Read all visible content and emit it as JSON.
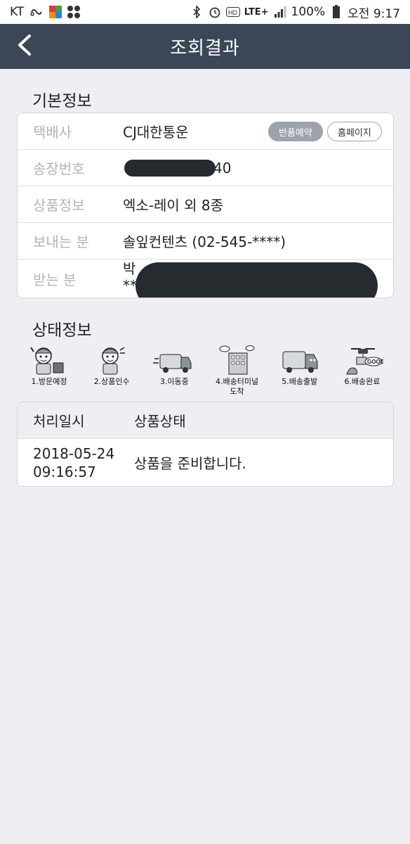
{
  "status_bar": {
    "carrier": "KT",
    "battery": "100%",
    "time": "오전 9:17",
    "network": "LTE+"
  },
  "header": {
    "title": "조회결과"
  },
  "basic_info": {
    "title": "기본정보",
    "rows": [
      {
        "label": "택배사",
        "value": "CJ대한통운"
      },
      {
        "label": "송장번호",
        "value_suffix": "40"
      },
      {
        "label": "상품정보",
        "value": "엑소-레이 외 8종"
      },
      {
        "label": "보내는 분",
        "value": "솔잎컨텐츠 (02-545-****)"
      },
      {
        "label": "받는 분",
        "value_line1": "박",
        "value_line2": "**"
      }
    ],
    "return_button": "반품예약",
    "homepage_button": "홈페이지"
  },
  "status_info": {
    "title": "상태정보",
    "steps": [
      {
        "label": "1.방문예정",
        "icon": "courier-visit-icon"
      },
      {
        "label": "2.상품인수",
        "icon": "courier-pickup-icon"
      },
      {
        "label": "3.이동중",
        "icon": "truck-moving-icon"
      },
      {
        "label_line1": "4.배송터미널",
        "label_line2": "도착",
        "icon": "terminal-building-icon"
      },
      {
        "label": "5.배송출발",
        "icon": "delivery-truck-icon"
      },
      {
        "label": "6.배송완료",
        "icon": "drone-good-icon"
      }
    ],
    "table": {
      "headers": [
        "처리일시",
        "상품상태"
      ],
      "rows": [
        {
          "date": "2018-05-24",
          "time": "09:16:57",
          "status": "상품을 준비합니다."
        }
      ]
    }
  },
  "colors": {
    "header_bg": "#3b4656",
    "page_bg": "#efeef3",
    "muted_label": "#b3b3b8"
  }
}
